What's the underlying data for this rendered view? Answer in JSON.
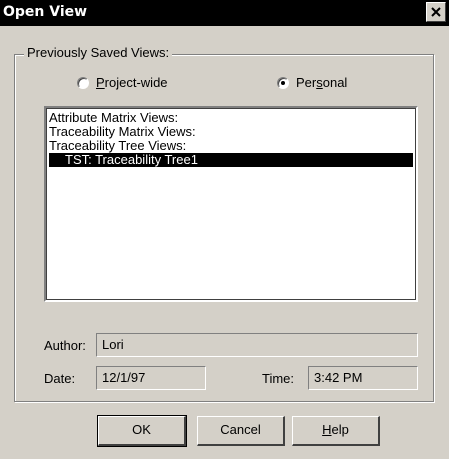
{
  "window": {
    "title": "Open View",
    "close_icon": "close-icon"
  },
  "group": {
    "label": "Previously Saved Views:",
    "radios": [
      {
        "pre": "",
        "accel": "P",
        "post": "roject-wide",
        "checked": false
      },
      {
        "pre": "Per",
        "accel": "s",
        "post": "onal",
        "checked": true
      }
    ]
  },
  "list": {
    "items": [
      "Attribute Matrix Views:",
      "Traceability Matrix Views:",
      "Traceability Tree Views:",
      "TST: Traceability Tree1"
    ],
    "selected_index": 3
  },
  "author": {
    "label": "Author:",
    "value": "Lori"
  },
  "date": {
    "label": "Date:",
    "value": "12/1/97"
  },
  "time": {
    "label": "Time:",
    "value": "3:42 PM"
  },
  "buttons": {
    "ok": "OK",
    "cancel": "Cancel",
    "help_accel": "H",
    "help_rest": "elp"
  }
}
